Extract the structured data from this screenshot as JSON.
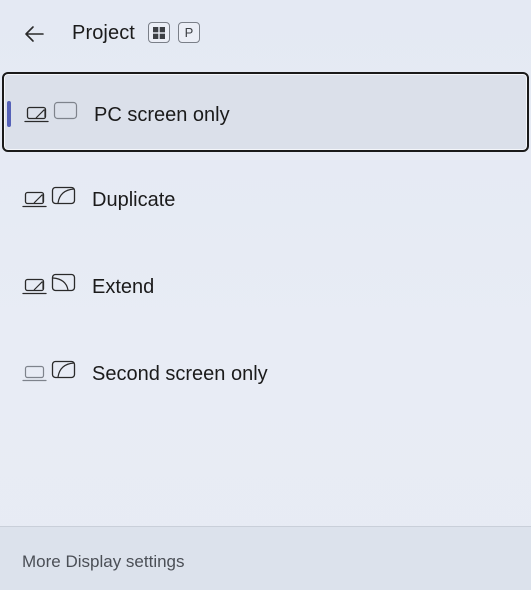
{
  "header": {
    "title": "Project",
    "shortcut_keys": [
      "⊞",
      "P"
    ],
    "back_icon": "back-arrow-icon"
  },
  "options": [
    {
      "label": "PC screen only",
      "icon": "pc-screen-only-icon",
      "selected": true
    },
    {
      "label": "Duplicate",
      "icon": "duplicate-icon",
      "selected": false
    },
    {
      "label": "Extend",
      "icon": "extend-icon",
      "selected": false
    },
    {
      "label": "Second screen only",
      "icon": "second-screen-only-icon",
      "selected": false
    }
  ],
  "footer": {
    "link_label": "More Display settings"
  },
  "colors": {
    "background": "#e6ebf4",
    "selection_indicator": "#5561b8",
    "selection_border": "#1a1a1a",
    "footer_background": "#dce2ec"
  }
}
